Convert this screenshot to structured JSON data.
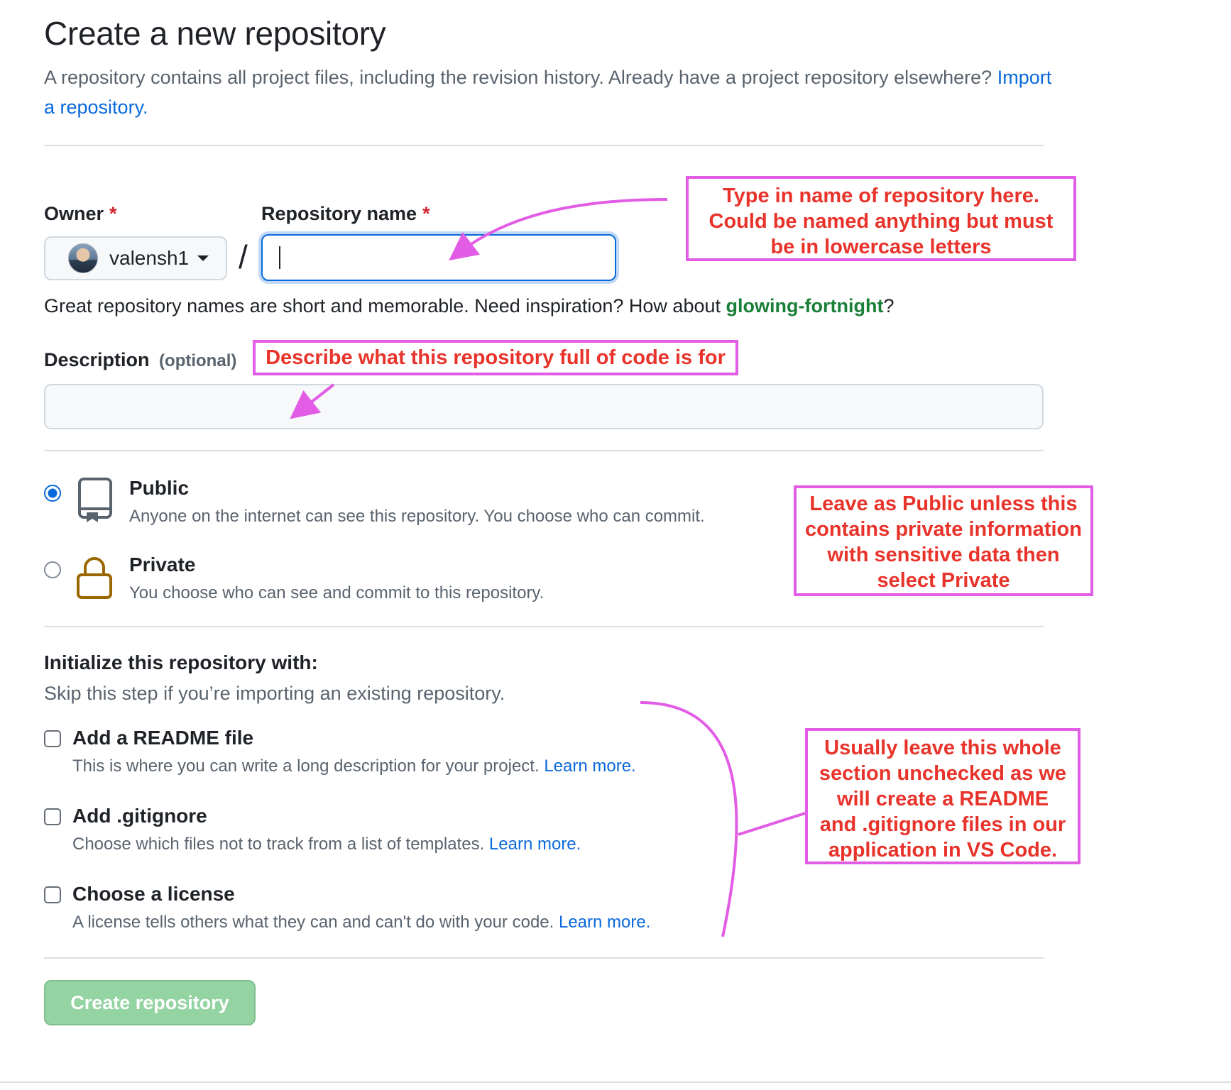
{
  "header": {
    "title": "Create a new repository",
    "lead_text": "A repository contains all project files, including the revision history. Already have a project repository elsewhere?",
    "import_link": "Import a repository."
  },
  "owner": {
    "label": "Owner",
    "required_mark": "*",
    "username": "valensh1"
  },
  "repo_name": {
    "label": "Repository name",
    "required_mark": "*",
    "value": "",
    "separator": "/"
  },
  "hint": {
    "text": "Great repository names are short and memorable. Need inspiration? How about",
    "suggestion": "glowing-fortnight",
    "end": "?"
  },
  "description": {
    "label": "Description",
    "optional": "(optional)",
    "value": ""
  },
  "visibility": {
    "public": {
      "title": "Public",
      "subtitle": "Anyone on the internet can see this repository. You choose who can commit.",
      "checked": true
    },
    "private": {
      "title": "Private",
      "subtitle": "You choose who can see and commit to this repository.",
      "checked": false
    }
  },
  "init": {
    "heading": "Initialize this repository with:",
    "subheading": "Skip this step if you’re importing an existing repository.",
    "options": [
      {
        "title": "Add a README file",
        "subtitle": "This is where you can write a long description for your project.",
        "link": "Learn more.",
        "checked": false
      },
      {
        "title": "Add .gitignore",
        "subtitle": "Choose which files not to track from a list of templates.",
        "link": "Learn more.",
        "checked": false
      },
      {
        "title": "Choose a license",
        "subtitle": "A license tells others what they can and can't do with your code.",
        "link": "Learn more.",
        "checked": false
      }
    ]
  },
  "create_button": "Create repository",
  "annotations": {
    "repo_name": [
      "Type in name of repository here.",
      "Could be named anything but must",
      "be in lowercase letters"
    ],
    "description": [
      "Describe what this repository full of code is for"
    ],
    "visibility": [
      "Leave as Public unless this",
      "contains private information",
      "with sensitive data then",
      "select Private"
    ],
    "init": [
      "Usually leave this whole",
      "section unchecked as we",
      "will create a README",
      "and .gitignore files in our",
      "application in VS Code."
    ]
  },
  "colors": {
    "accent": "#0969da",
    "annotation_border": "#e25ce6",
    "annotation_text": "#e8332b",
    "button_disabled": "#94d3a2",
    "suggestion": "#1a7f37"
  }
}
